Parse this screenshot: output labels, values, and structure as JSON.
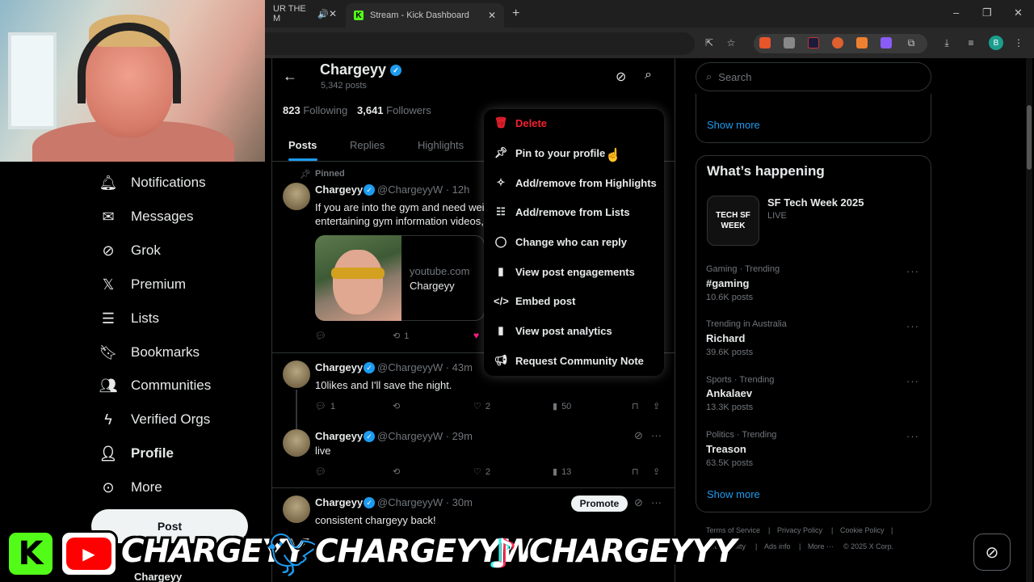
{
  "browser": {
    "tabs": [
      {
        "label": "UR THE M",
        "active": false
      },
      {
        "label": "Stream - Kick Dashboard",
        "active": true
      }
    ],
    "new_tab": "+",
    "window_controls": [
      "–",
      "❐",
      "✕"
    ],
    "profile_initial": "B"
  },
  "nav": {
    "items": [
      {
        "label": "Notifications",
        "icon": "bell-icon"
      },
      {
        "label": "Messages",
        "icon": "mail-icon"
      },
      {
        "label": "Grok",
        "icon": "grok-icon"
      },
      {
        "label": "Premium",
        "icon": "x-logo-icon"
      },
      {
        "label": "Lists",
        "icon": "list-icon"
      },
      {
        "label": "Bookmarks",
        "icon": "bookmark-icon"
      },
      {
        "label": "Communities",
        "icon": "people-icon"
      },
      {
        "label": "Verified Orgs",
        "icon": "bolt-icon"
      },
      {
        "label": "Profile",
        "icon": "person-icon"
      },
      {
        "label": "More",
        "icon": "more-circle-icon"
      }
    ],
    "post_button": "Post",
    "account_name": "Chargeyy"
  },
  "profile": {
    "name": "Chargeyy",
    "posts_count": "5,342 posts",
    "following_count": "823",
    "following_label": "Following",
    "followers_count": "3,641",
    "followers_label": "Followers",
    "tabs": [
      "Posts",
      "Replies",
      "Highlights"
    ],
    "active_tab": "Posts"
  },
  "feed": {
    "pinned_label": "Pinned",
    "posts": [
      {
        "name": "Chargeyy",
        "handle": "@ChargeyyW · 12h",
        "text_line1": "If you are into the gym and need weig",
        "text_line2": "entertaining gym information videos,",
        "card_domain": "youtube.com",
        "card_title": "Chargeyy",
        "reposts": "1"
      },
      {
        "name": "Chargeyy",
        "handle": "@ChargeyyW · 43m",
        "text": "10likes and I'll save the night.",
        "replies": "1",
        "likes": "2",
        "views": "50"
      },
      {
        "name": "Chargeyy",
        "handle": "@ChargeyyW · 29m",
        "text": "live",
        "likes": "2",
        "views": "13"
      },
      {
        "name": "Chargeyy",
        "handle": "@ChargeyyW · 30m",
        "text": "consistent chargeyy back!",
        "promote": "Promote"
      }
    ]
  },
  "menu": {
    "items": [
      {
        "label": "Delete",
        "icon": "trash-icon",
        "danger": true
      },
      {
        "label": "Pin to your profile",
        "icon": "pin-icon"
      },
      {
        "label": "Add/remove from Highlights",
        "icon": "sparkle-icon"
      },
      {
        "label": "Add/remove from Lists",
        "icon": "list-add-icon"
      },
      {
        "label": "Change who can reply",
        "icon": "reply-bubble-icon"
      },
      {
        "label": "View post engagements",
        "icon": "bar-chart-icon"
      },
      {
        "label": "Embed post",
        "icon": "code-icon"
      },
      {
        "label": "View post analytics",
        "icon": "analytics-icon"
      },
      {
        "label": "Request Community Note",
        "icon": "megaphone-icon"
      }
    ]
  },
  "right": {
    "search_placeholder": "Search",
    "show_more": "Show more",
    "whats_happening": "What’s happening",
    "event": {
      "title": "SF Tech Week 2025",
      "status": "LIVE",
      "thumb_text": "TECH SF WEEK"
    },
    "trends": [
      {
        "category": "Gaming · Trending",
        "title": "#gaming",
        "count": "10.6K posts"
      },
      {
        "category": "Trending in Australia",
        "title": "Richard",
        "count": "39.6K posts"
      },
      {
        "category": "Sports · Trending",
        "title": "Ankalaev",
        "count": "13.3K posts"
      },
      {
        "category": "Politics · Trending",
        "title": "Treason",
        "count": "63.5K posts"
      }
    ],
    "show_more_2": "Show more",
    "footer": [
      "Terms of Service",
      "|",
      "Privacy Policy",
      "|",
      "Cookie Policy",
      "|",
      "Accessibility",
      "|",
      "Ads info",
      "|",
      "More ···",
      "© 2025 X Corp."
    ]
  },
  "overlay": {
    "handle1": "CHARGEYY",
    "handle2": "CHARGEYYW",
    "handle3": "CHARGEYYY"
  },
  "colors": {
    "accent": "#1d9bf0",
    "danger": "#f4212e",
    "kick_green": "#53fc18",
    "youtube_red": "#ff0000",
    "twitter_blue": "#1d9bf0"
  }
}
